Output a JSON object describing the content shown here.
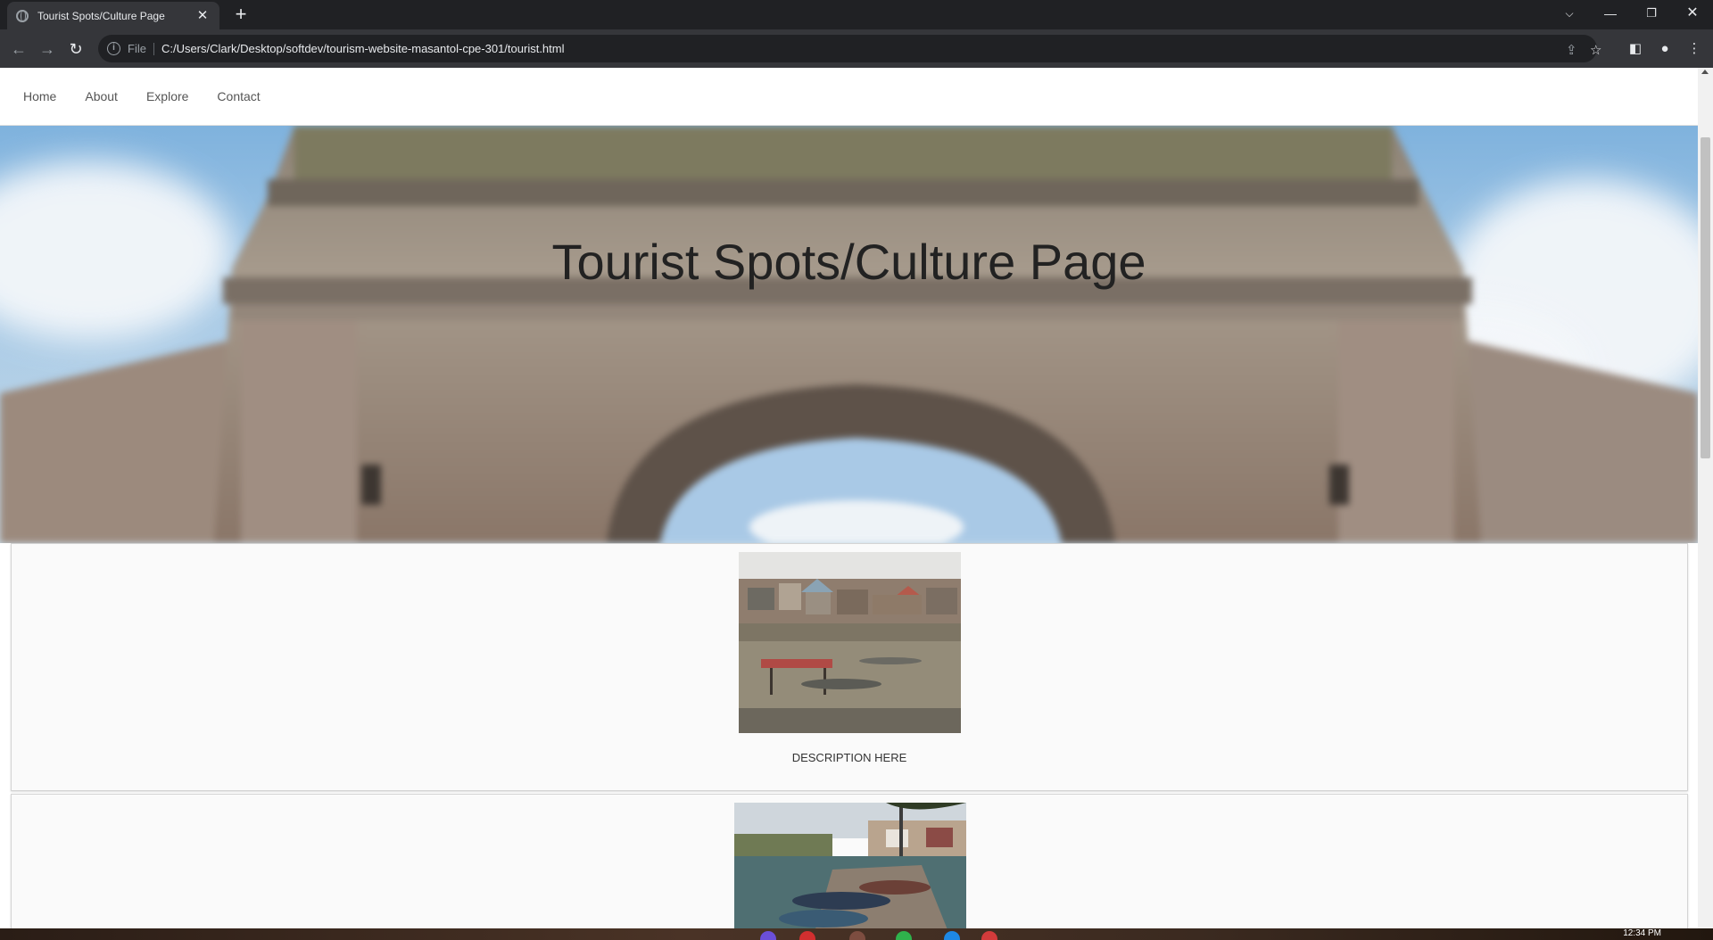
{
  "browser": {
    "tab_title": "Tourist Spots/Culture Page",
    "url_scheme_label": "File",
    "url": "C:/Users/Clark/Desktop/softdev/tourism-website-masantol-cpe-301/tourist.html"
  },
  "site": {
    "nav": [
      {
        "label": "Home"
      },
      {
        "label": "About"
      },
      {
        "label": "Explore"
      },
      {
        "label": "Contact"
      }
    ],
    "hero_title": "Tourist Spots/Culture Page",
    "cards": [
      {
        "description": "DESCRIPTION HERE"
      }
    ]
  },
  "taskbar": {
    "clock": "12:34 PM"
  },
  "colors": {
    "chrome_bg": "#202124",
    "toolbar_bg": "#35363a",
    "nav_text": "#555555",
    "title_text": "#222222"
  }
}
